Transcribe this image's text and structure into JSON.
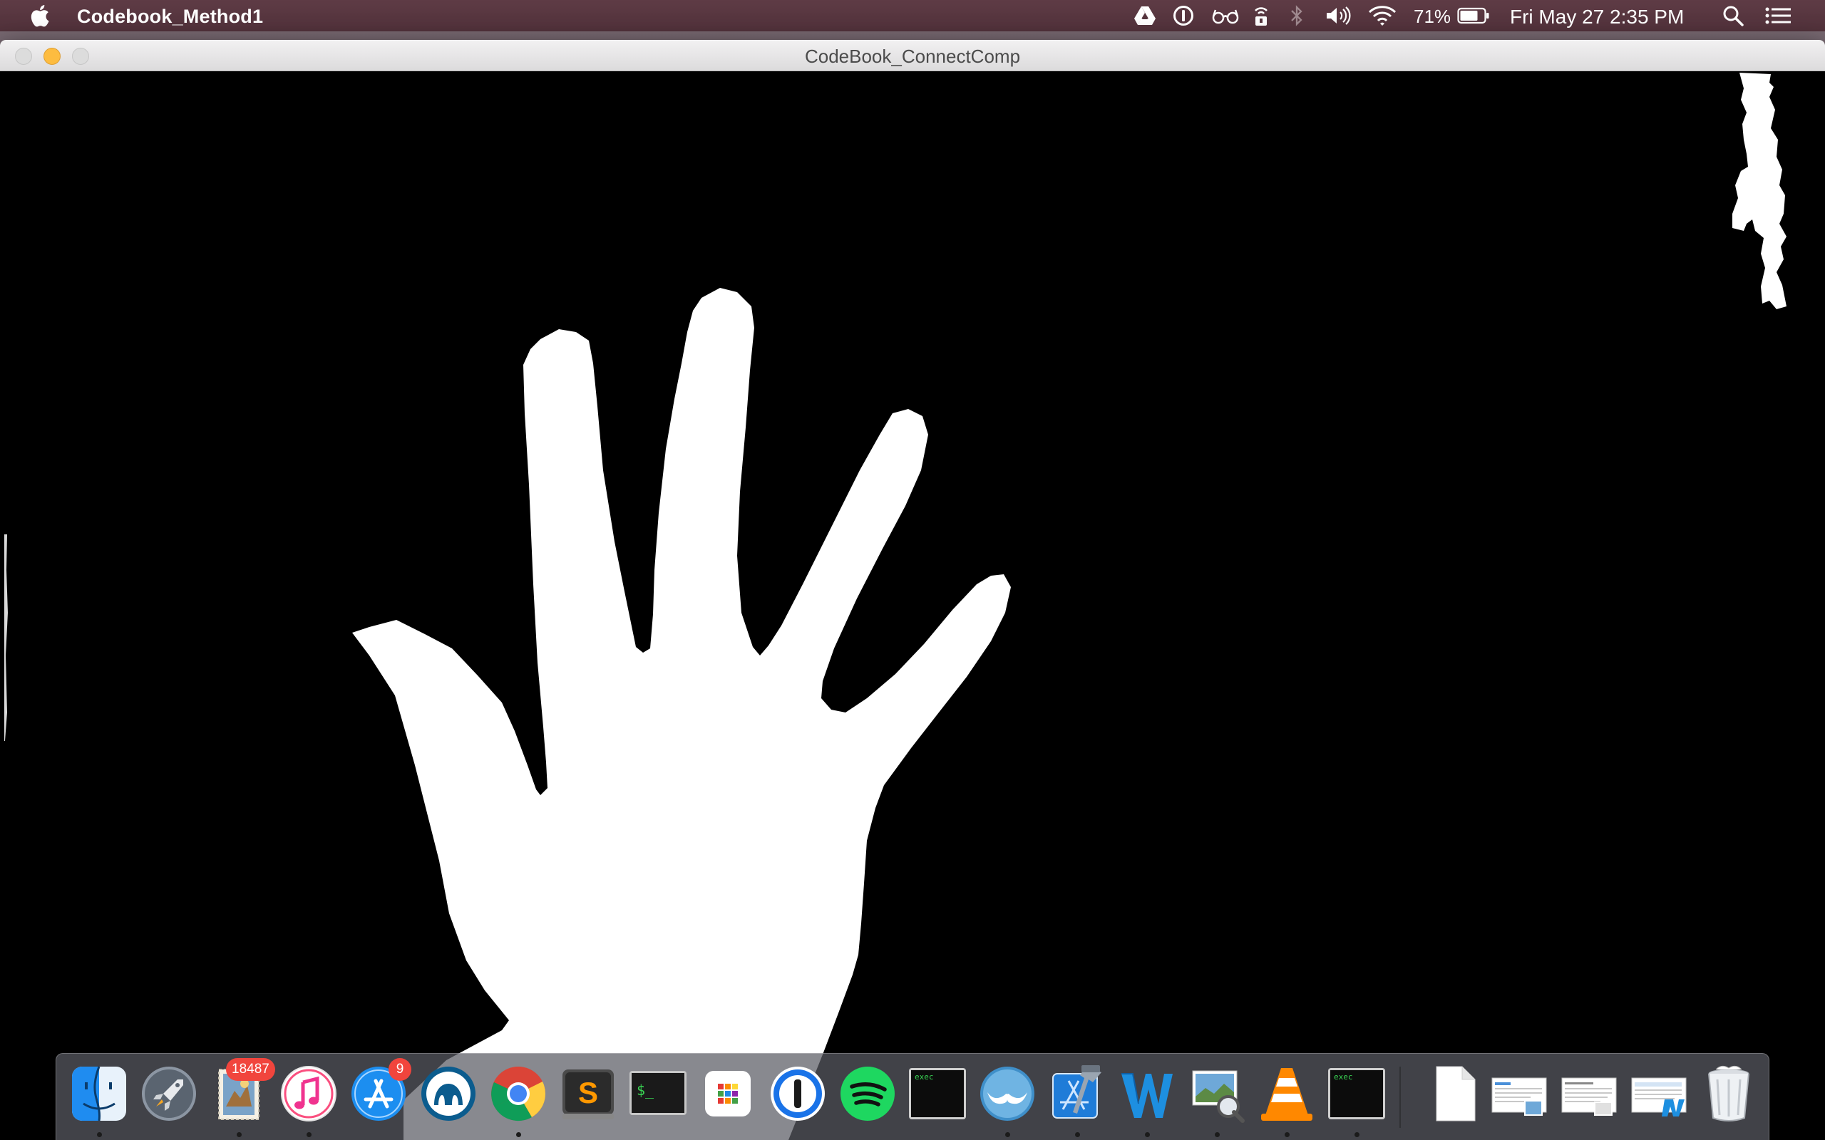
{
  "menubar": {
    "app_name": "Codebook_Method1",
    "battery_percent": "71%",
    "clock": "Fri May 27  2:35 PM",
    "status_icons": [
      "google-drive-icon",
      "1password-icon",
      "glasses-icon",
      "wifi-hotspot-icon",
      "bluetooth-icon",
      "volume-icon",
      "wifi-icon",
      "battery-icon",
      "spotlight-search-icon",
      "notification-center-icon"
    ]
  },
  "window": {
    "title": "CodeBook_ConnectComp",
    "content": "binary foreground mask: white hand silhouette on black background"
  },
  "dock": {
    "items": [
      {
        "name": "finder",
        "icon": "finder-icon",
        "running": true
      },
      {
        "name": "launchpad",
        "icon": "rocket-icon",
        "running": false
      },
      {
        "name": "mail",
        "icon": "mail-stamp-icon",
        "running": true,
        "badge": "18487"
      },
      {
        "name": "itunes",
        "icon": "music-note-icon",
        "running": true
      },
      {
        "name": "app-store",
        "icon": "app-store-icon",
        "running": false,
        "badge": "9"
      },
      {
        "name": "mysql-workbench",
        "icon": "dolphin-icon",
        "running": false
      },
      {
        "name": "chrome",
        "icon": "chrome-icon",
        "running": true
      },
      {
        "name": "sublime-text",
        "icon": "sublime-icon",
        "running": false
      },
      {
        "name": "terminal",
        "icon": "terminal-icon",
        "running": false
      },
      {
        "name": "grid-app",
        "icon": "grid-icon",
        "running": false
      },
      {
        "name": "1password",
        "icon": "keyhole-icon",
        "running": false
      },
      {
        "name": "spotify",
        "icon": "spotify-icon",
        "running": false
      },
      {
        "name": "exec-1",
        "icon": "exec-terminal-icon",
        "running": false,
        "label": "exec"
      },
      {
        "name": "mustache-app",
        "icon": "mustache-icon",
        "running": true
      },
      {
        "name": "xcode",
        "icon": "xcode-icon",
        "running": true
      },
      {
        "name": "word",
        "icon": "word-w-icon",
        "running": true
      },
      {
        "name": "preview",
        "icon": "preview-icon",
        "running": true
      },
      {
        "name": "vlc",
        "icon": "vlc-cone-icon",
        "running": true
      },
      {
        "name": "exec-2",
        "icon": "exec-terminal-icon",
        "running": true,
        "label": "exec"
      },
      {
        "name": "document",
        "icon": "blank-document-icon",
        "running": false
      },
      {
        "name": "downloads-stack-1",
        "icon": "document-stack-icon",
        "running": false
      },
      {
        "name": "downloads-stack-2",
        "icon": "document-stack-icon",
        "running": false
      },
      {
        "name": "downloads-stack-3",
        "icon": "document-stack-icon",
        "running": false
      },
      {
        "name": "trash",
        "icon": "trash-icon",
        "running": false
      }
    ]
  },
  "colors": {
    "menubar": "#55343d",
    "mask_foreground": "#ffffff",
    "mask_background": "#000000",
    "minimize_button": "#fdbc40",
    "badge": "#f1453d"
  }
}
